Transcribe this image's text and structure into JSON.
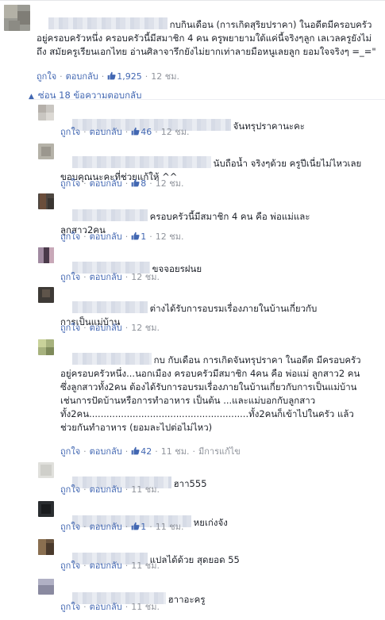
{
  "main_comment": {
    "text": "กบกินเดือน (การเกิดสุริยปราคา) ในอดีตมีครอบครัวอยู่ครอบครัวหนึ่ง ครอบครัวนี้มีสมาชิก 4 คน ครูพยายามใต้แค่นี้จริงๆลูก เลเวลครูยังไม่ถึง สมัยครูเรียนเอกไทย อ่านศิลาจารึกยังไม่ยากเท่าลายมือหนูเลยลูก ยอมใจจริงๆ =_=\"",
    "like_label": "ถูกใจ",
    "reply_label": "ตอบกลับ",
    "likes": "1,925",
    "time": "12 ชม."
  },
  "hide_replies_label": "ซ่อน 18 ข้อความตอบกลับ",
  "replies": [
    {
      "text": "จันทรุปราคานะคะ",
      "like_label": "ถูกใจ",
      "reply_label": "ตอบกลับ",
      "likes": "46",
      "time": "12 ชม."
    },
    {
      "text": "นับถือน้ำ จริงๆด้วย ครูปีเนี่ยไม่ไหวเลย ขอบคุณนะคะที่ช่วยแก้ให้ ^^",
      "like_label": "ถูกใจ",
      "reply_label": "ตอบกลับ",
      "likes": "8",
      "time": "12 ชม."
    },
    {
      "text": "ครอบครัวนี้มีสมาชิก 4 คน คือ พ่อแม่และลูกสาว2คน",
      "like_label": "ถูกใจ",
      "reply_label": "ตอบกลับ",
      "likes": "1",
      "time": "12 ชม."
    },
    {
      "text": "ขจจอยรฝนย",
      "like_label": "ถูกใจ",
      "reply_label": "ตอบกลับ",
      "likes": "",
      "time": "12 ชม."
    },
    {
      "text": "ต่างได้รับการอบรมเรื่องภายในบ้านเกี่ยวกับการเป็นแม่บ้าน",
      "like_label": "ถูกใจ",
      "reply_label": "ตอบกลับ",
      "likes": "",
      "time": "12 ชม."
    },
    {
      "text": "กบ กับเดือน การเกิดจันทรุปราคา ในอดีต มีครอบครัว อยู่ครอบครัวหนึ่ง...นอกเมือง ครอบครัวมีสมาชิก 4คน คือ พ่อแม่ ลูกสาว2 คน ซึ่งลูกสาวทั้ง2คน ต้องได้รับการอบรมเรื่องภายในบ้านเกี่ยวกับการเป็นแม่บ้าน เช่นการปัดบ้านหรือการทำอาหาร เป็นต้น ...และแม่บอกกับลูกสาวทั้ง2คน.......................................................ทั้ง2คนก็เข้าไปในครัว แล้วช่วยกันทำอาหาร (ยอมละไปต่อไม่ไหว)",
      "like_label": "ถูกใจ",
      "reply_label": "ตอบกลับ",
      "likes": "42",
      "time": "11 ชม.",
      "edited": "มีการแก้ไข"
    },
    {
      "text": "ฮาา555",
      "like_label": "ถูกใจ",
      "reply_label": "ตอบกลับ",
      "likes": "",
      "time": "11 ชม."
    },
    {
      "text": "หยเก่งจัง",
      "like_label": "ถูกใจ",
      "reply_label": "ตอบกลับ",
      "likes": "1",
      "time": "11 ชม."
    },
    {
      "text": "แปลได้ด้วย สุดยอด 55",
      "like_label": "ถูกใจ",
      "reply_label": "ตอบกลับ",
      "likes": "",
      "time": "11 ชม."
    },
    {
      "text": "ฮาาอะครู",
      "like_label": "ถูกใจ",
      "reply_label": "ตอบกลับ",
      "likes": "",
      "time": "11 ชม."
    }
  ],
  "colors": {
    "link": "#4267b2",
    "meta": "#90949c",
    "text": "#1d2129"
  }
}
